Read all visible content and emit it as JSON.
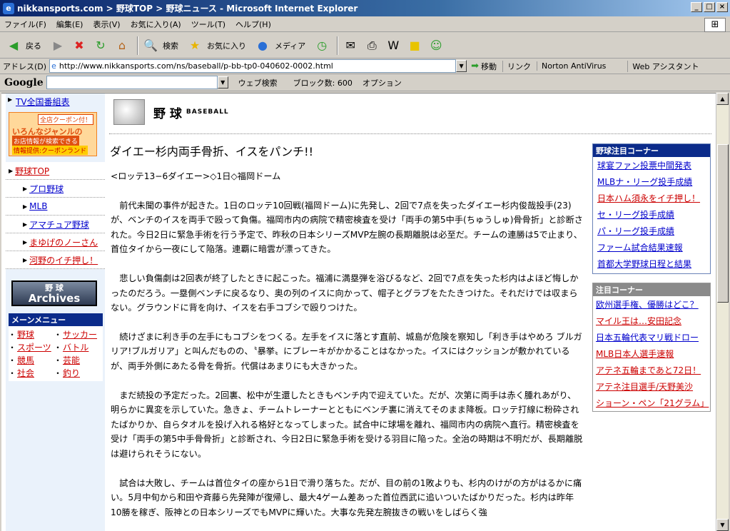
{
  "window": {
    "title": "nikkansports.com > 野球TOP > 野球ニュース - Microsoft Internet Explorer"
  },
  "menu": [
    "ファイル(F)",
    "編集(E)",
    "表示(V)",
    "お気に入り(A)",
    "ツール(T)",
    "ヘルプ(H)"
  ],
  "toolbar": {
    "back": "戻る",
    "search": "検索",
    "favorites": "お気に入り",
    "media": "メディア"
  },
  "address": {
    "label": "アドレス(D)",
    "url": "http://www.nikkansports.com/ns/baseball/p-bb-tp0-040602-0002.html",
    "go": "移動",
    "links": "リンク",
    "norton": "Norton AntiVirus",
    "webassist": "Web アシスタント"
  },
  "google": {
    "logo": "Google",
    "search": "ウェブ検索",
    "blocks": "ブロック数: 600",
    "options": "オプション"
  },
  "left": {
    "tv": "TV全国番組表",
    "coupon": {
      "tag": "全店クーポン付！",
      "line1": "いろんなジャンルの",
      "line2": "お店情報が検索できる",
      "line3": "情報提供:クーポンランド"
    },
    "nav": [
      "野球TOP",
      "プロ野球",
      "MLB",
      "アマチュア野球",
      "まゆげのノーさん",
      "河野のイチ押し！"
    ],
    "archives": {
      "top": "野 球",
      "bottom": "Archives"
    },
    "menu_title": "メーンメニュー",
    "menu": [
      "野球",
      "サッカー",
      "スポーツ",
      "バトル",
      "競馬",
      "芸能",
      "社会",
      "釣り"
    ]
  },
  "header": {
    "jp": "野 球",
    "en": "BASEBALL"
  },
  "article": {
    "headline": "ダイエー杉内両手骨折、イスをパンチ!!",
    "paras": [
      "<ロッテ13−6ダイエー>◇1日◇福岡ドーム",
      "前代未聞の事件が起きた。1日のロッテ10回戦(福岡ドーム)に先発し、2回で7点を失ったダイエー杉内俊哉投手(23)が、ベンチのイスを両手で殴って負傷。福岡市内の病院で精密検査を受け「両手の第5中手(ちゅうしゅ)骨骨折」と診断された。今日2日に緊急手術を行う予定で、昨秋の日本シリーズMVP左腕の長期離脱は必至だ。チームの連勝は5で止まり、首位タイから一夜にして陥落。連覇に暗雲が漂ってきた。",
      "悲しい負傷劇は2回表が終了したときに起こった。福浦に満塁弾を浴びるなど、2回で7点を失った杉内はよほど悔しかったのだろう。一塁側ベンチに戻るなり、奥の列のイスに向かって、帽子とグラブをたたきつけた。それだけでは収まらない。グラウンドに背を向け、イスを右手コブシで殴りつけた。",
      "続けざまに利き手の左手にもコブシをつくる。左手をイスに落とす直前、城島が危険を察知し「利き手はやめろ ブルガリア!ブルガリア」と叫んだものの、〝暴挙〟にブレーキがかかることはなかった。イスにはクッションが敷かれているが、両手外側にあたる骨を骨折。代償はあまりにも大きかった。",
      "まだ続投の予定だった。2回裏、松中が生還したときもベンチ内で迎えていた。だが、次第に両手は赤く腫れあがり、明らかに異変を示していた。急きょ、チームトレーナーとともにベンチ裏に消えてそのまま降板。ロッテ打線に粉砕されたばかりか、自らタオルを投げ入れる格好となってしまった。試合中に球場を離れ、福岡市内の病院へ直行。精密検査を受け「両手の第5中手骨骨折」と診断され、今日2日に緊急手術を受ける羽目に陥った。全治の時期は不明だが、長期離脱は避けられそうにない。",
      "試合は大敗し、チームは首位タイの座から1日で滑り落ちた。だが、目の前の1敗よりも、杉内のけがの方がはるかに痛い。5月中旬から和田や斉藤ら先発陣が復帰し、最大4ゲーム差あった首位西武に追いついたばかりだった。杉内は昨年10勝を稼ぎ、阪神との日本シリーズでもMVPに輝いた。大事な先発左腕抜きの戦いをしばらく強"
    ]
  },
  "right": {
    "box1_title": "野球注目コーナー",
    "box1": [
      "球宴ファン投票中間発表",
      "MLBナ・リーグ投手成績",
      "日本ハム須永をイチ押し！",
      "セ・リーグ投手成績",
      "パ・リーグ投手成績",
      "ファーム試合結果速報",
      "首都大学野球日程と結果"
    ],
    "box2_title": "注目コーナー",
    "box2": [
      "欧州選手権、優勝はどこ？",
      "マイル王は…安田記念",
      "日本五輪代表マリ戦ドロー",
      "MLB日本人選手速報",
      "アテネ五輪まであと72日！",
      "アテネ注目選手/天野美沙",
      "ショーン・ペン「21グラム」"
    ]
  },
  "colors": {
    "link": "#0000cc",
    "red_link": "#cc0000",
    "navy": "#0b2b8a"
  }
}
